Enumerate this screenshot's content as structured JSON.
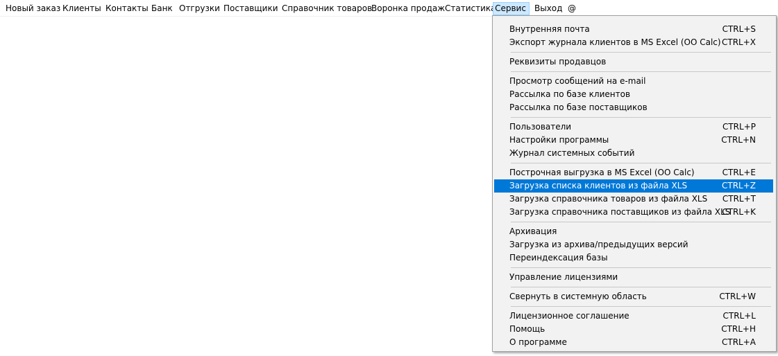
{
  "menubar": {
    "items": [
      {
        "label": "Новый заказ"
      },
      {
        "label": "Клиенты"
      },
      {
        "label": "Контакты"
      },
      {
        "label": "Банк"
      },
      {
        "label": "Отгрузки"
      },
      {
        "label": "Поставщики"
      },
      {
        "label": "Справочник товаров"
      },
      {
        "label": "Воронка продаж"
      },
      {
        "label": "Статистика"
      },
      {
        "label": "Сервис"
      },
      {
        "label": "Выход"
      },
      {
        "label": "@"
      }
    ],
    "active": "Сервис"
  },
  "service_menu": {
    "items": [
      {
        "label": "Внутренняя почта",
        "shortcut": "CTRL+S"
      },
      {
        "label": "Экспорт журнала клиентов в MS Excel (OO Calc)",
        "shortcut": "CTRL+X"
      },
      {
        "label": "Реквизиты продавцов",
        "shortcut": ""
      },
      {
        "label": "Просмотр сообщений на e-mail",
        "shortcut": ""
      },
      {
        "label": "Рассылка по базе клиентов",
        "shortcut": ""
      },
      {
        "label": "Рассылка по базе поставщиков",
        "shortcut": ""
      },
      {
        "label": "Пользователи",
        "shortcut": "CTRL+P"
      },
      {
        "label": "Настройки программы",
        "shortcut": "CTRL+N"
      },
      {
        "label": "Журнал системных событий",
        "shortcut": ""
      },
      {
        "label": "Построчная выгрузка в MS Excel (OO Calc)",
        "shortcut": "CTRL+E"
      },
      {
        "label": "Загрузка списка клиентов из файла XLS",
        "shortcut": "CTRL+Z"
      },
      {
        "label": "Загрузка справочника товаров из файла XLS",
        "shortcut": "CTRL+T"
      },
      {
        "label": "Загрузка справочника поставщиков из файла XLS",
        "shortcut": "CTRL+K"
      },
      {
        "label": "Архивация",
        "shortcut": ""
      },
      {
        "label": "Загрузка из архива/предыдущих версий",
        "shortcut": ""
      },
      {
        "label": "Переиндексация базы",
        "shortcut": ""
      },
      {
        "label": "Управление лицензиями",
        "shortcut": ""
      },
      {
        "label": "Свернуть в системную область",
        "shortcut": "CTRL+W"
      },
      {
        "label": "Лицензионное соглашение",
        "shortcut": "CTRL+L"
      },
      {
        "label": "Помощь",
        "shortcut": "CTRL+H"
      },
      {
        "label": "О программе",
        "shortcut": "CTRL+A"
      }
    ],
    "highlighted": "Загрузка списка клиентов из файла XLS"
  },
  "colors": {
    "highlight_bg": "#0078d7",
    "active_menu_bg": "#cce8ff",
    "menu_bg": "#f2f2f2"
  }
}
